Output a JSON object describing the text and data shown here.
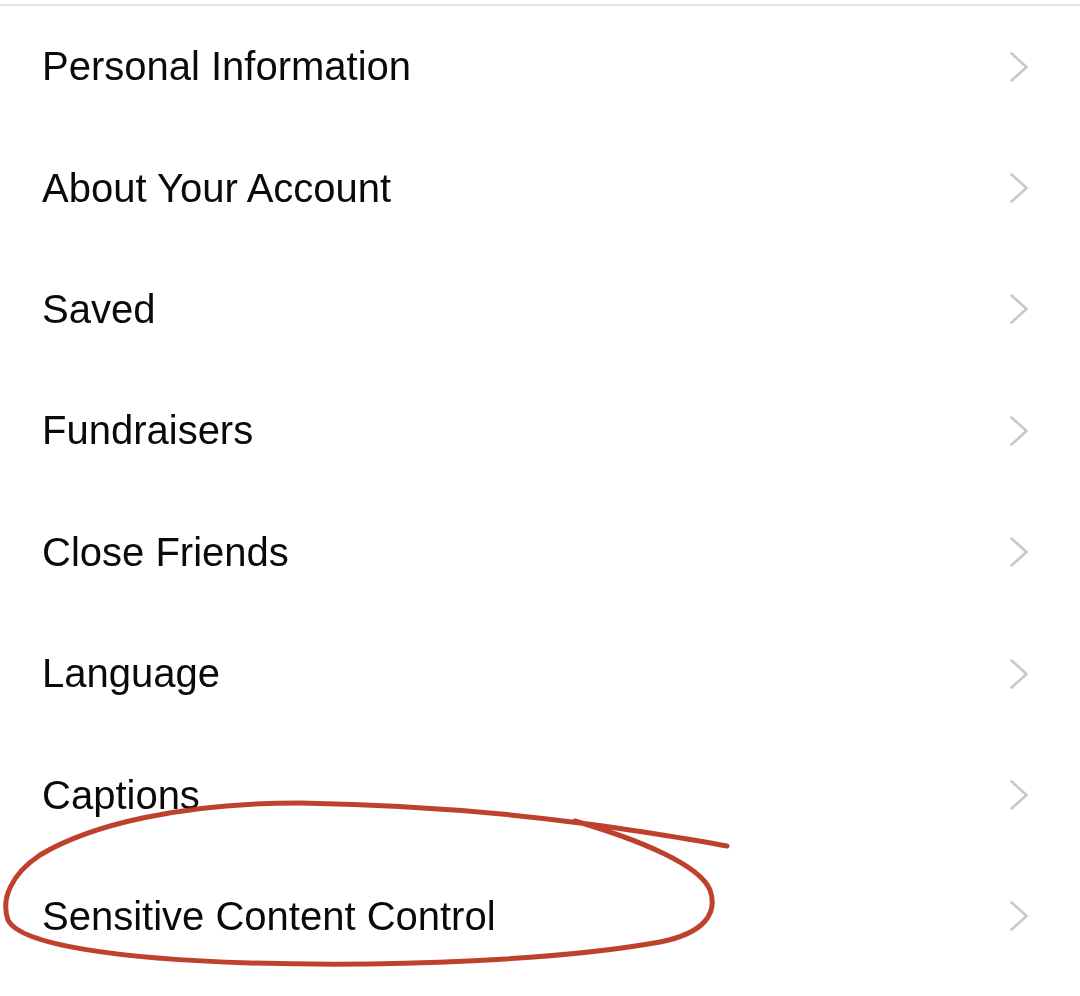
{
  "rows": [
    {
      "label": "Personal Information",
      "circled": false
    },
    {
      "label": "About Your Account",
      "circled": false
    },
    {
      "label": "Saved",
      "circled": false
    },
    {
      "label": "Fundraisers",
      "circled": false
    },
    {
      "label": "Close Friends",
      "circled": false
    },
    {
      "label": "Language",
      "circled": false
    },
    {
      "label": "Captions",
      "circled": false
    },
    {
      "label": "Sensitive Content Control",
      "circled": true
    }
  ]
}
